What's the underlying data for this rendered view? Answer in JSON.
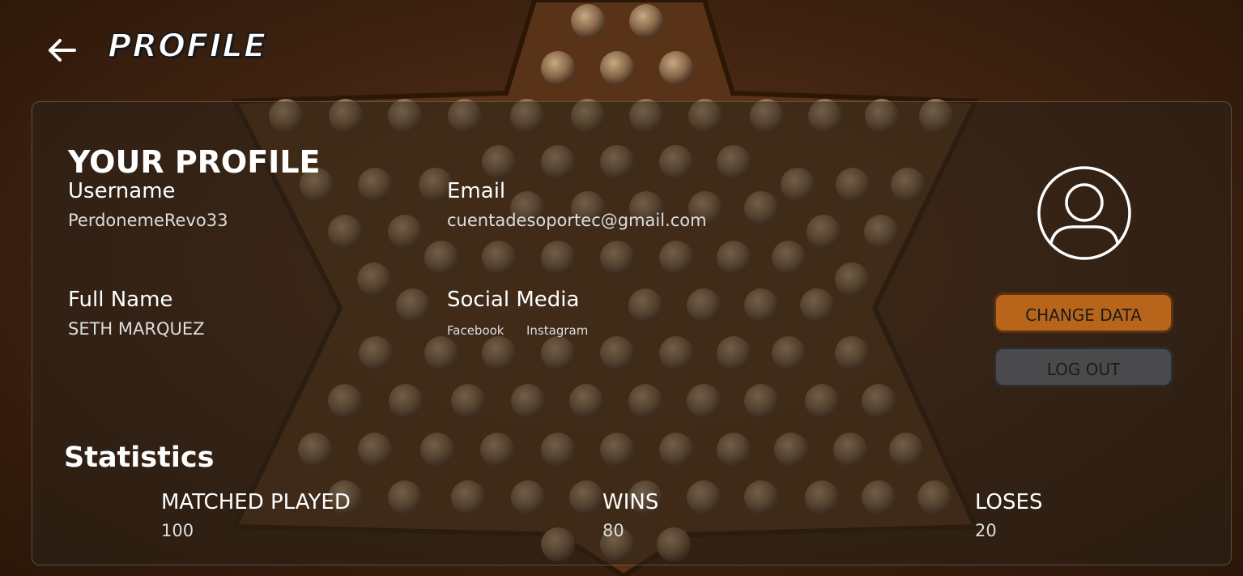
{
  "header": {
    "back_icon": "back-arrow-icon",
    "title": "PROFILE"
  },
  "profile": {
    "heading": "YOUR PROFILE",
    "username_label": "Username",
    "username_value": "PerdonemeRevo33",
    "email_label": "Email",
    "email_value": "cuentadesoportec@gmail.com",
    "fullname_label": "Full Name",
    "fullname_value": "SETH MARQUEZ",
    "social_label": "Social Media",
    "social_links": [
      "Facebook",
      "Instagram"
    ],
    "avatar_icon": "user-avatar-icon"
  },
  "actions": {
    "change_data_label": "CHANGE DATA",
    "logout_label": "LOG OUT"
  },
  "statistics": {
    "heading": "Statistics",
    "matched_label": "MATCHED PLAYED",
    "matched_value": "100",
    "wins_label": "WINS",
    "wins_value": "80",
    "loses_label": "LOSES",
    "loses_value": "20"
  },
  "colors": {
    "background_wood": "#4a2a12",
    "panel": "#2c221a",
    "change_button": "#b8651b",
    "logout_button": "#4a4a4c",
    "text": "#ffffff"
  }
}
